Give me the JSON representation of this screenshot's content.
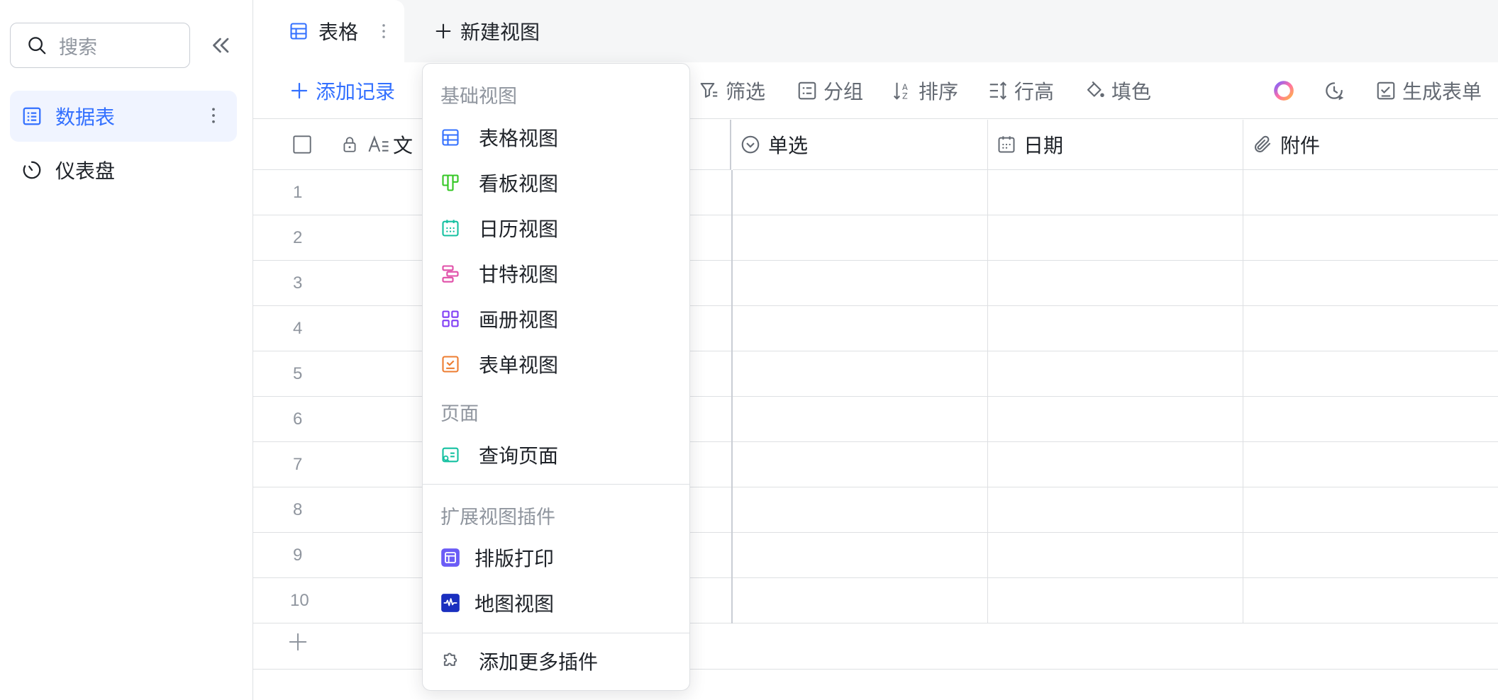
{
  "sidebar": {
    "search_placeholder": "搜索",
    "items": [
      {
        "label": "数据表",
        "icon": "table-list-icon",
        "active": true
      },
      {
        "label": "仪表盘",
        "icon": "dashboard-icon",
        "active": false
      }
    ]
  },
  "tabs": {
    "current_tab": "表格",
    "new_view": "新建视图"
  },
  "toolbar": {
    "add_record": "添加记录",
    "filter": "筛选",
    "group": "分组",
    "sort": "排序",
    "row_height": "行高",
    "fill_color": "填色",
    "generate_form": "生成表单"
  },
  "grid": {
    "columns": [
      {
        "label": "文",
        "icon": "text-field-icon"
      },
      {
        "label": "单选",
        "icon": "single-select-icon"
      },
      {
        "label": "日期",
        "icon": "date-icon"
      },
      {
        "label": "附件",
        "icon": "attachment-icon"
      }
    ],
    "rows": [
      "1",
      "2",
      "3",
      "4",
      "5",
      "6",
      "7",
      "8",
      "9",
      "10"
    ]
  },
  "menu": {
    "group_basic": "基础视图",
    "basic_items": [
      {
        "label": "表格视图",
        "icon": "grid-view-icon",
        "color": "#3370ff"
      },
      {
        "label": "看板视图",
        "icon": "kanban-view-icon",
        "color": "#34c724"
      },
      {
        "label": "日历视图",
        "icon": "calendar-view-icon",
        "color": "#14c0a0"
      },
      {
        "label": "甘特视图",
        "icon": "gantt-view-icon",
        "color": "#e04fa8"
      },
      {
        "label": "画册视图",
        "icon": "gallery-view-icon",
        "color": "#7f3bf5"
      },
      {
        "label": "表单视图",
        "icon": "form-view-icon",
        "color": "#ed7d31"
      }
    ],
    "group_page": "页面",
    "page_items": [
      {
        "label": "查询页面",
        "icon": "query-page-icon",
        "color": "#14c0a0"
      }
    ],
    "group_plugins": "扩展视图插件",
    "plugin_items": [
      {
        "label": "排版打印",
        "icon": "print-layout-icon",
        "color": "#6b5cf6"
      },
      {
        "label": "地图视图",
        "icon": "map-view-icon",
        "color": "#1a2fbf"
      }
    ],
    "add_more": "添加更多插件"
  }
}
